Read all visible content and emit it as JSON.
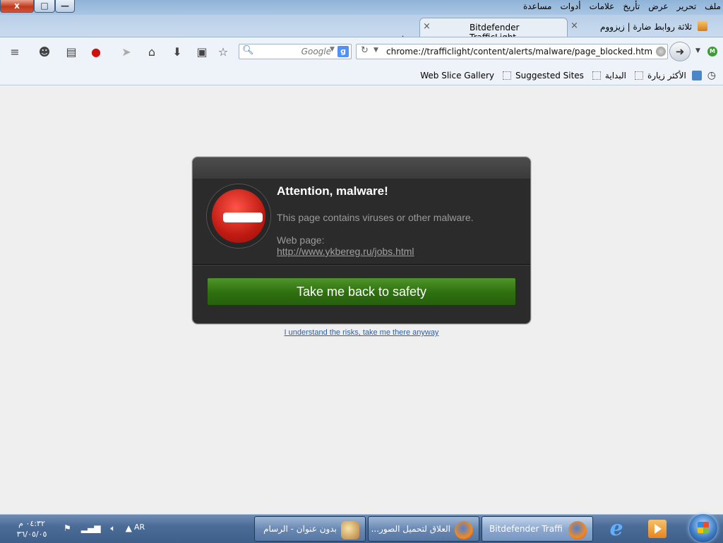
{
  "window": {
    "close_label": "x",
    "max_label": "□",
    "min_label": "—"
  },
  "menu": [
    "ملف",
    "تحرير",
    "عرض",
    "تأريخ",
    "علامات",
    "أدوات",
    "مساعدة"
  ],
  "tabs": [
    {
      "title": "Bitdefender TrafficLight",
      "active": true
    },
    {
      "title": "ثلاثة روابط ضارة | زيزووم ...",
      "active": false
    }
  ],
  "new_tab_label": "+",
  "close_glyph": "×",
  "search": {
    "placeholder": "Google",
    "engine_label": "g"
  },
  "address": {
    "url": "chrome://trafficlight/content/alerts/malware/page_blocked.html?url=h"
  },
  "bookmarks": [
    "الأكثر زيارة",
    "البداية",
    "Suggested Sites",
    "Web Slice Gallery"
  ],
  "alert": {
    "title": "Attention, malware!",
    "message": "This page contains viruses or other malware.",
    "webpage_label": "Web page:",
    "blocked_url": "http://www.ykbereg.ru/jobs.html",
    "safety_button": "Take me back to safety",
    "risk_link": "I understand the risks, take me there anyway"
  },
  "taskbar": {
    "clock_time": "٠٤:٣٢ م",
    "clock_date": "٣٦/٠٥/٠٥",
    "language": "AR",
    "tasks": [
      {
        "label": "بدون عنوان - الرسام"
      },
      {
        "label": "العلاق لتحميل الصور..."
      },
      {
        "label": "Bitdefender Traffi..."
      }
    ]
  },
  "colors": {
    "dialog_bg": "#2b2b2b",
    "safety_button": "#3f8a1f",
    "stop_red": "#d9271c",
    "link": "#2f5f9e"
  }
}
